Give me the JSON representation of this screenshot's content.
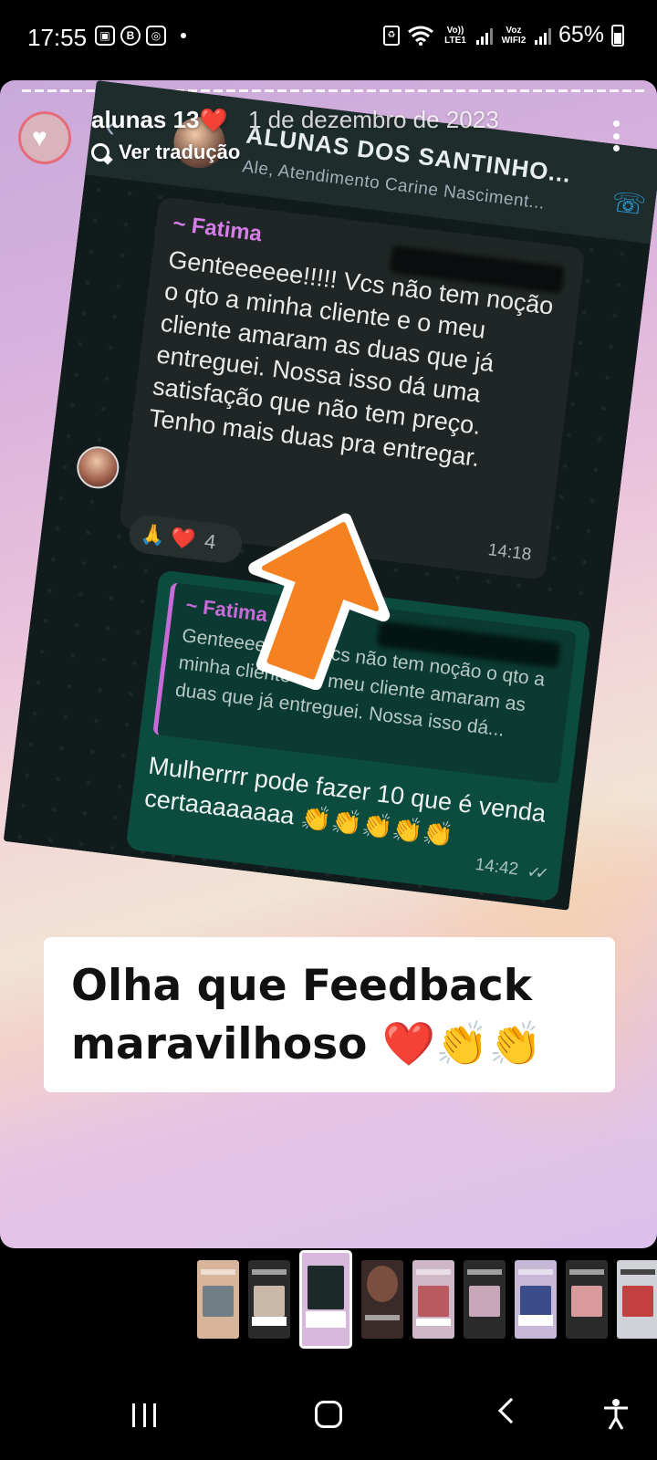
{
  "status_bar": {
    "time": "17:55",
    "left_icons": [
      "image-icon",
      "b-icon",
      "instagram-icon",
      "dot"
    ],
    "network1": "Vo)) LTE1",
    "network2": "Voz WIFI2",
    "battery": "65%"
  },
  "story": {
    "username": "alunas 13",
    "username_emoji": "❤️",
    "date": "1 de dezembro de 2023",
    "translate_label": "Ver tradução"
  },
  "whatsapp": {
    "group_title": "ALUNAS DOS SANTINHO...",
    "group_subtitle": "Ale, Atendimento Carine Nasciment...",
    "incoming": {
      "sender": "~ Fatima",
      "text": "Genteeeeee!!!!! Vcs não tem noção o qto a minha cliente e o meu cliente  amaram as duas que já entreguei. Nossa isso dá uma satisfação que não tem preço. Tenho mais duas pra entregar.",
      "time": "14:18",
      "reactions": "🙏 ❤️",
      "reaction_count": "4"
    },
    "outgoing": {
      "quote_sender": "~ Fatima",
      "quote_text": "Genteeeeee!!!!! Vcs não tem noção o qto a minha cliente e o meu cliente  amaram as duas que já entreguei. Nossa isso dá...",
      "text": "Mulherrrr pode fazer 10 que é venda certaaaaaaaa 👏👏👏👏👏",
      "time": "14:42",
      "ticks": "✓✓"
    }
  },
  "caption": {
    "line1": "Olha que Feedback",
    "line2": "maravilhoso",
    "emojis": "❤️👏👏"
  },
  "thumbnails": {
    "count_visible": 9,
    "active_index": 2,
    "colors": [
      "#d8b59a",
      "#2b2b2b",
      "#1c2a2a",
      "#3a2b2a",
      "#cfb7c7",
      "#2a2a2a",
      "#c8b8d8",
      "#2a2a2a",
      "#cfd2d6"
    ]
  },
  "colors": {
    "wa_bg": "#121b1b",
    "wa_incoming": "#1f2625",
    "wa_outgoing": "#0c4c3f",
    "sender_purple": "#d67de8",
    "arrow_orange": "#f58220"
  }
}
